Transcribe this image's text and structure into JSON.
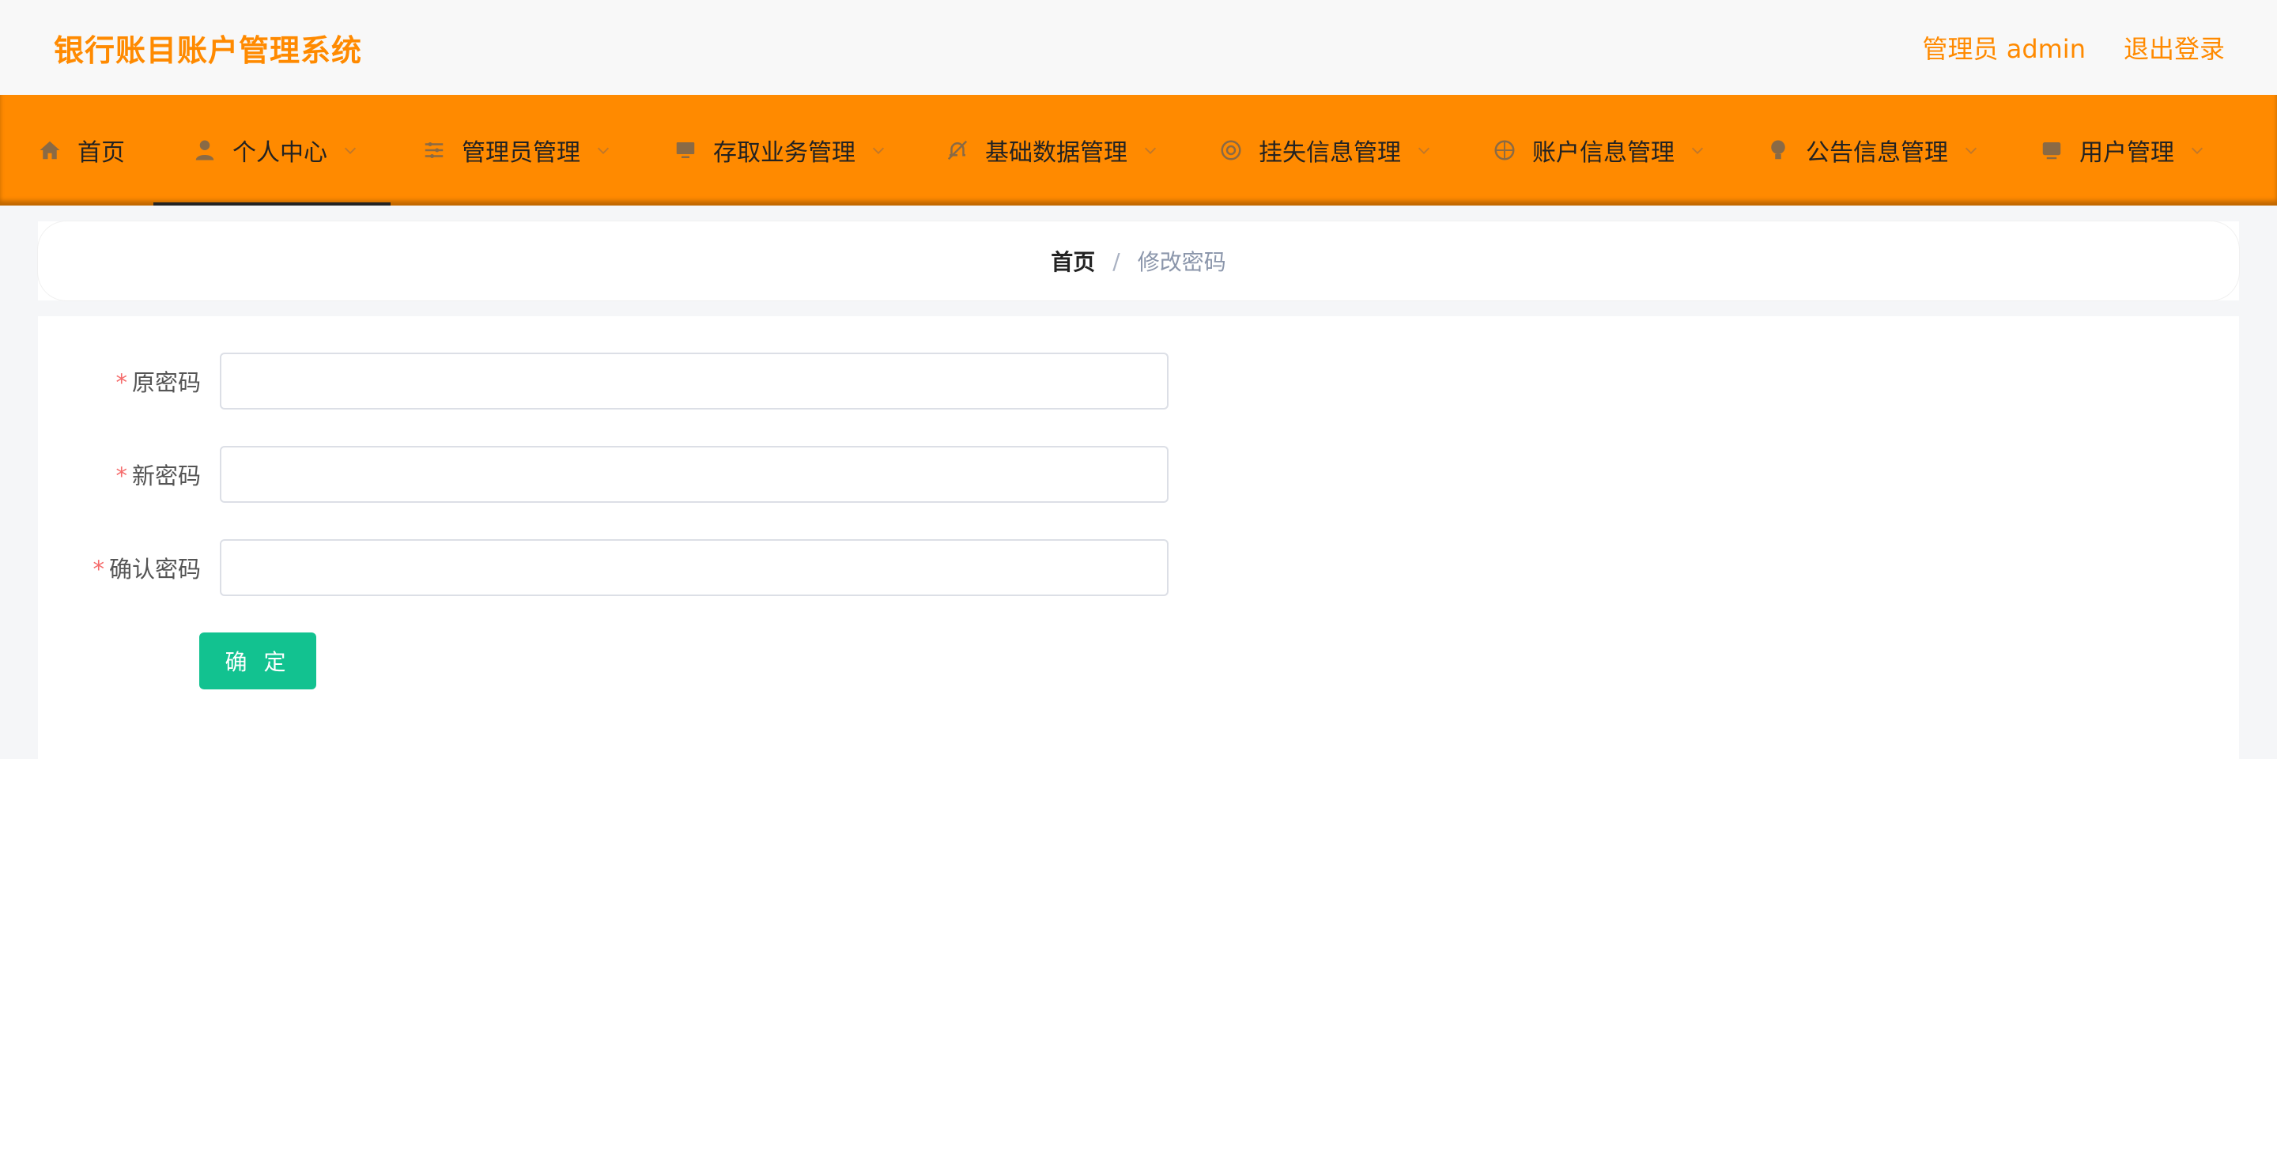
{
  "header": {
    "title": "银行账目账户管理系统",
    "admin_label": "管理员 admin",
    "logout_label": "退出登录",
    "brand_color": "#ff8a00"
  },
  "nav": {
    "items": [
      {
        "label": "首页",
        "icon": "home-icon"
      },
      {
        "label": "个人中心",
        "icon": "user-icon"
      },
      {
        "label": "管理员管理",
        "icon": "sliders-icon"
      },
      {
        "label": "存取业务管理",
        "icon": "monitor-icon"
      },
      {
        "label": "基础数据管理",
        "icon": "bell-off-icon"
      },
      {
        "label": "挂失信息管理",
        "icon": "lifebuoy-icon"
      },
      {
        "label": "账户信息管理",
        "icon": "compass-icon"
      },
      {
        "label": "公告信息管理",
        "icon": "bulb-icon"
      },
      {
        "label": "用户管理",
        "icon": "screen-icon"
      }
    ],
    "active": "个人中心"
  },
  "breadcrumb": {
    "home": "首页",
    "separator": "/",
    "current": "修改密码"
  },
  "form": {
    "old_password_label": "原密码",
    "new_password_label": "新密码",
    "confirm_password_label": "确认密码",
    "required_mark": "*",
    "old_password_value": "",
    "new_password_value": "",
    "confirm_password_value": "",
    "submit_label": "确 定",
    "submit_color": "#12c290"
  }
}
